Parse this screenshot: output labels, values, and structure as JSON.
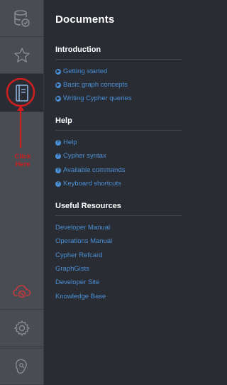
{
  "rail": {
    "icons": [
      {
        "name": "database-icon"
      },
      {
        "name": "star-icon"
      },
      {
        "name": "book-icon"
      },
      {
        "name": "cloud-disconnect-icon"
      },
      {
        "name": "gear-icon"
      },
      {
        "name": "plugin-icon"
      }
    ],
    "annotation": {
      "label_line1": "Click",
      "label_line2": "Here"
    }
  },
  "panel": {
    "title": "Documents",
    "sections": [
      {
        "heading": "Introduction",
        "links": [
          "Getting started",
          "Basic graph concepts",
          "Writing Cypher queries"
        ]
      },
      {
        "heading": "Help",
        "links": [
          "Help",
          "Cypher syntax",
          "Available commands",
          "Keyboard shortcuts"
        ]
      },
      {
        "heading": "Useful Resources",
        "links": [
          "Developer Manual",
          "Operations Manual",
          "Cypher Refcard",
          "GraphGists",
          "Developer Site",
          "Knowledge Base"
        ]
      }
    ]
  },
  "colors": {
    "rail_bg": "#4a4c54",
    "panel_bg": "#2a2c33",
    "link": "#4a90d6",
    "annotation_red": "#cc1f1f",
    "icon_gray": "#8a8c94",
    "active_icon": "#8fb4e0"
  }
}
